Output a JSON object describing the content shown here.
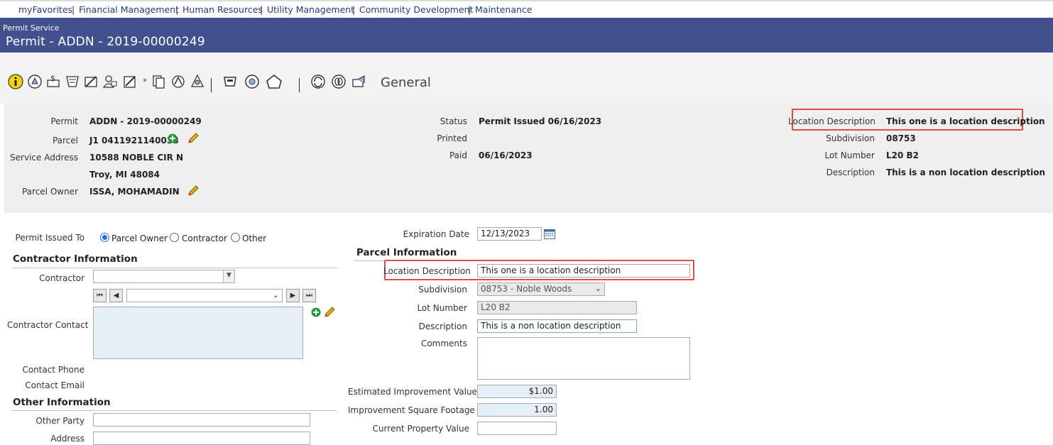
{
  "nav": {
    "items": [
      "myFavorites",
      "Financial Management",
      "Human Resources",
      "Utility Management",
      "Community Development",
      "Maintenance"
    ],
    "separator": "|"
  },
  "header": {
    "subtitle": "Permit Service",
    "title": "Permit - ADDN - 2019-00000249"
  },
  "toolbar": {
    "section_label": "General",
    "asterisk": "*",
    "icons": [
      "info-icon",
      "permit-icon",
      "fee-icon",
      "inspection-icon",
      "review-icon",
      "contact-icon",
      "notes-icon",
      "copy-icon",
      "attach-icon",
      "print-icon",
      "bond-icon",
      "hold-icon",
      "home-icon",
      "refresh-icon",
      "link-icon",
      "email-icon"
    ]
  },
  "info": {
    "permit_label": "Permit",
    "permit_value": "ADDN - 2019-00000249",
    "parcel_label": "Parcel",
    "parcel_value": "J1 0411921140038",
    "service_address_label": "Service Address",
    "address_line1": "10588 NOBLE CIR N",
    "address_line2": "Troy, MI 48084",
    "parcel_owner_label": "Parcel Owner",
    "parcel_owner_value": "ISSA, MOHAMADIN",
    "status_label": "Status",
    "status_value": "Permit Issued 06/16/2023",
    "printed_label": "Printed",
    "printed_value": "",
    "paid_label": "Paid",
    "paid_value": "06/16/2023",
    "location_description_label": "Location Description",
    "location_description_value": "This one is a location description",
    "subdivision_label": "Subdivision",
    "subdivision_value": "08753",
    "lot_number_label": "Lot Number",
    "lot_number_value": "L20 B2",
    "description_label": "Description",
    "description_value": "This is a non location description"
  },
  "form": {
    "permit_issued_to_label": "Permit Issued To",
    "issued_to_options": [
      "Parcel Owner",
      "Contractor",
      "Other"
    ],
    "issued_to_selected": "Parcel Owner",
    "contractor_section": "Contractor Information",
    "contractor_label": "Contractor",
    "contractor_value": "",
    "contractor_contact_label": "Contractor Contact",
    "contact_phone_label": "Contact Phone",
    "contact_email_label": "Contact Email",
    "other_section": "Other Information",
    "other_party_label": "Other Party",
    "address_label": "Address",
    "expiration_date_label": "Expiration Date",
    "expiration_date_value": "12/13/2023",
    "parcel_section": "Parcel Information",
    "location_description_label": "Location Description",
    "location_description_value": "This one is a location description",
    "subdivision_label": "Subdivision",
    "subdivision_value": "08753 - Noble Woods",
    "lot_number_label": "Lot Number",
    "lot_number_value": "L20 B2",
    "description_label": "Description",
    "description_value": "This is a non location description",
    "comments_label": "Comments",
    "comments_value": "",
    "est_improvement_label": "Estimated Improvement Value",
    "est_improvement_value": "$1.00",
    "improvement_sqft_label": "Improvement Square Footage",
    "improvement_sqft_value": "1.00",
    "current_property_label": "Current Property Value",
    "current_property_value": ""
  },
  "colors": {
    "header_bg": "#41508f",
    "highlight": "#e24a4a",
    "link": "#1f3a8a",
    "add_green": "#1e9a3a",
    "edit_yellow": "#e8b400"
  }
}
